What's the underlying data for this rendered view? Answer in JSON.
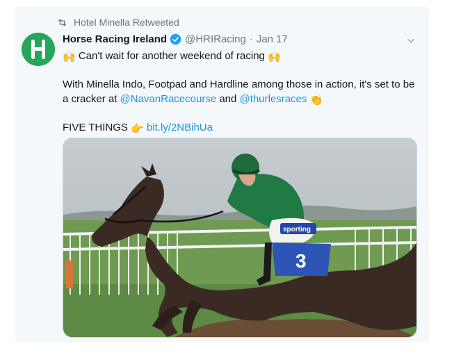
{
  "retweet": {
    "label": "Hotel Minella Retweeted",
    "icon": "retweet-icon"
  },
  "author": {
    "name": "Horse Racing Ireland",
    "handle": "@HRIRacing",
    "separator": "·",
    "date": "Jan 17",
    "verified": true,
    "avatar_letter": "H",
    "avatar_color": "#27a55a"
  },
  "tweet": {
    "line1": "Can't wait for another weekend of racing",
    "line2_text": "With Minella Indo, Footpad and Hardline among those in action, it's set to be a cracker at ",
    "mention1": "@NavanRacecourse",
    "and_text": " and ",
    "mention2": "@thurlesraces",
    "line3_text": "FIVE THINGS",
    "link": "bit.ly/2NBihUa"
  },
  "media": {
    "icon": "racehorse-jumping-photo",
    "saddle_cloth_number": "3",
    "sponsor_text": "sporting"
  },
  "colors": {
    "link": "#1b95e0",
    "meta": "#657786",
    "verified": "#1da1f2"
  }
}
